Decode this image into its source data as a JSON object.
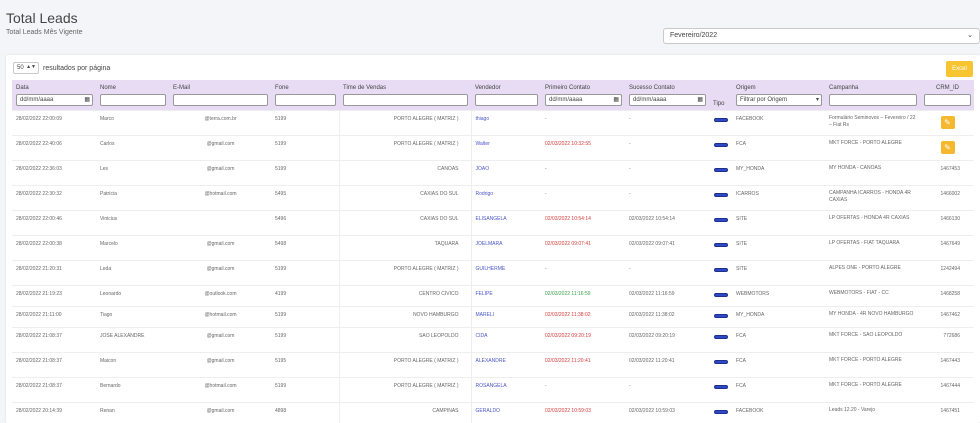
{
  "header": {
    "title": "Total Leads",
    "subtitle": "Total Leads Mês Vigente",
    "month_select": "Fevereiro/2022"
  },
  "length_menu": {
    "value": "50",
    "label": "resultados por página"
  },
  "excel_label": "Excel",
  "columns": {
    "data": "Data",
    "nome": "Nome",
    "email": "E-Mail",
    "fone": "Fone",
    "time": "Time de Vendas",
    "vendedor": "Vendedor",
    "primeiro": "Primeiro Contato",
    "sucesso": "Sucesso Contato",
    "tipo": "Tipo",
    "origem": "Origem",
    "campanha": "Campanha",
    "crm": "CRM_ID"
  },
  "filters": {
    "date_placeholder": "dd/mm/aaaa",
    "origem_placeholder": "Filtrar por Origem"
  },
  "rows": [
    {
      "data": "28/02/2022 22:00:09",
      "nome": "Marco",
      "email": "@terra.com.br",
      "fone": "5199",
      "time": "PORTO ALEGRE ( MATRIZ )",
      "vendedor": "thiago",
      "primeiro": "-",
      "sucesso": "-",
      "origem": "FACEBOOK",
      "campanha": "Formulário Seminovos – Fevereiro / 22 – Fiat Rs",
      "crm": ""
    },
    {
      "data": "28/02/2022 22:40:06",
      "nome": "Carlos",
      "email": "@gmail.com",
      "fone": "5199",
      "time": "PORTO ALEGRE ( MATRIZ )",
      "vendedor": "Walter",
      "primeiro": "02/03/2022 10:32:55",
      "sucesso": "-",
      "origem": "FCA",
      "campanha": "MKT FORCE - PORTO ALEGRE",
      "crm": ""
    },
    {
      "data": "28/02/2022 22:36:03",
      "nome": "Les",
      "email": "@gmail.com",
      "fone": "5199",
      "time": "CANOAS",
      "vendedor": "JOAO",
      "primeiro": "-",
      "sucesso": "-",
      "origem": "MY_HONDA",
      "campanha": "MY HONDA - CANOAS",
      "crm": "1467453"
    },
    {
      "data": "28/02/2022 22:30:32",
      "nome": "Patrícia",
      "email": "@hotmail.com",
      "fone": "5495",
      "time": "CAXIAS DO SUL",
      "vendedor": "Rodrigo",
      "primeiro": "-",
      "sucesso": "-",
      "origem": "ICARROS",
      "campanha": "CAMPANHA ICARROS - HONDA 4R CAXIAS",
      "crm": "1466002"
    },
    {
      "data": "28/02/2022 22:00:46",
      "nome": "Vinicius",
      "email": "",
      "fone": "5496",
      "time": "CAXIAS DO SUL",
      "vendedor": "ELISANGELA",
      "primeiro": "02/03/2022 10:54:14",
      "sucesso": "02/03/2022 10:54:14",
      "origem": "SITE",
      "campanha": "LP OFERTAS - HONDA 4R CAXIAS",
      "crm": "1466130"
    },
    {
      "data": "28/02/2022 22:00:38",
      "nome": "Marcelo",
      "email": "@gmail.com",
      "fone": "5498",
      "time": "TAQUARA",
      "vendedor": "JOELMARA",
      "primeiro": "02/03/2022 09:07:41",
      "sucesso": "02/03/2022 09:07:41",
      "origem": "SITE",
      "campanha": "LP OFERTAS - FIAT TAQUARA",
      "crm": "1467649"
    },
    {
      "data": "28/02/2022 21:20:31",
      "nome": "Leda",
      "email": "@gmail.com",
      "fone": "5199",
      "time": "PORTO ALEGRE ( MATRIZ )",
      "vendedor": "GUILHERME",
      "primeiro": "-",
      "sucesso": "-",
      "origem": "SITE",
      "campanha": "ALPES ONE - PORTO ALEGRE",
      "crm": "1242494"
    },
    {
      "data": "28/02/2022 21:19:23",
      "nome": "Leonardo",
      "email": "@outlook.com",
      "fone": "4199",
      "time": "CENTRO CIVICO",
      "vendedor": "FELIPE",
      "primeiro": "02/03/2022 11:16:59",
      "sucesso": "02/03/2022 11:16:59",
      "origem": "WEBMOTORS",
      "campanha": "WEBMOTORS - FIAT - CC",
      "crm": "1468258"
    },
    {
      "data": "28/02/2022 21:11:00",
      "nome": "Tiago",
      "email": "@hotmail.com",
      "fone": "5199",
      "time": "NOVO HAMBURGO",
      "vendedor": "MARELI",
      "primeiro": "02/03/2022 11:38:02",
      "sucesso": "02/03/2022 11:38:02",
      "origem": "MY_HONDA",
      "campanha": "MY HONDA - 4R NOVO HAMBURGO",
      "crm": "1467462"
    },
    {
      "data": "28/02/2022 21:08:37",
      "nome": "JOSE ALEXANDRE",
      "email": "@gmail.com",
      "fone": "5199",
      "time": "SAO LEOPOLDO",
      "vendedor": "CIDA",
      "primeiro": "02/03/2022 09:20:19",
      "sucesso": "02/03/2022 09:20:19",
      "origem": "FCA",
      "campanha": "MKT FORCE - SAO LEOPOLDO",
      "crm": "772686"
    },
    {
      "data": "28/02/2022 21:08:37",
      "nome": "Maicon",
      "email": "@gmail.com",
      "fone": "5195",
      "time": "PORTO ALEGRE ( MATRIZ )",
      "vendedor": "ALEXANDRE",
      "primeiro": "02/03/2022 11:20:41",
      "sucesso": "02/03/2022 11:20:41",
      "origem": "FCA",
      "campanha": "MKT FORCE - PORTO ALEGRE",
      "crm": "1467443"
    },
    {
      "data": "28/02/2022 21:08:37",
      "nome": "Bernardo",
      "email": "@hotmail.com",
      "fone": "5199",
      "time": "PORTO ALEGRE ( MATRIZ )",
      "vendedor": "ROSANGELA",
      "primeiro": "-",
      "sucesso": "-",
      "origem": "FCA",
      "campanha": "MKT FORCE - PORTO ALEGRE",
      "crm": "1467444"
    },
    {
      "data": "28/02/2022 20:14:39",
      "nome": "Renan",
      "email": "@gmail.com",
      "fone": "4898",
      "time": "CAMPINAS",
      "vendedor": "GERALDO",
      "primeiro": "02/03/2022 10:59:03",
      "sucesso": "02/03/2022 10:59:03",
      "origem": "FACEBOOK",
      "campanha": "Leads 12.20 - Varejo",
      "crm": "1467451"
    }
  ]
}
